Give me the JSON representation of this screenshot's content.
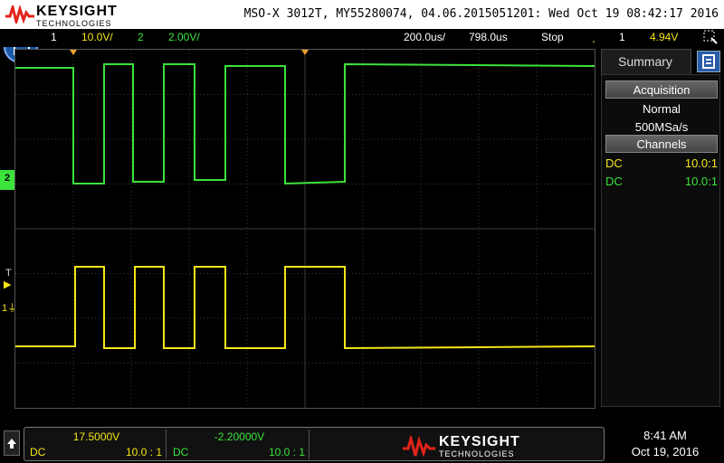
{
  "header": {
    "brand": "KEYSIGHT",
    "brand_sub": "TECHNOLOGIES",
    "instrument_info": "MSO-X 3012T, MY55280074, 04.06.2015051201: Wed Oct 19 08:42:17 2016"
  },
  "status": {
    "ch1_num": "1",
    "ch1_scale": "10.0V/",
    "ch2_num": "2",
    "ch2_scale": "2.00V/",
    "timebase": "200.0us/",
    "delay": "798.0us",
    "run_state": "Stop",
    "trigger_source": "1",
    "trigger_level": "4.94V"
  },
  "markers": {
    "ch2": "2",
    "trigger": "T",
    "ch1": "1"
  },
  "sidebar": {
    "tab_label": "Summary",
    "acquisition_label": "Acquisition",
    "acq_mode": "Normal",
    "sample_rate": "500MSa/s",
    "channels_label": "Channels",
    "channels": [
      {
        "coupling": "DC",
        "probe": "10.0:1"
      },
      {
        "coupling": "DC",
        "probe": "10.0:1"
      }
    ]
  },
  "bottom": {
    "ch1_offset": "17.5000V",
    "ch1_coupling": "DC",
    "ch1_probe": "10.0 : 1",
    "ch2_offset": "-2.20000V",
    "ch2_coupling": "DC",
    "ch2_probe": "10.0 : 1",
    "brand": "KEYSIGHT",
    "brand_sub": "TECHNOLOGIES",
    "time": "8:41 AM",
    "date": "Oct 19, 2016"
  },
  "colors": {
    "ch1": "#f5e617",
    "ch2": "#3be33b",
    "accent": "#2a5ba8",
    "logo_red": "#e2231a"
  }
}
